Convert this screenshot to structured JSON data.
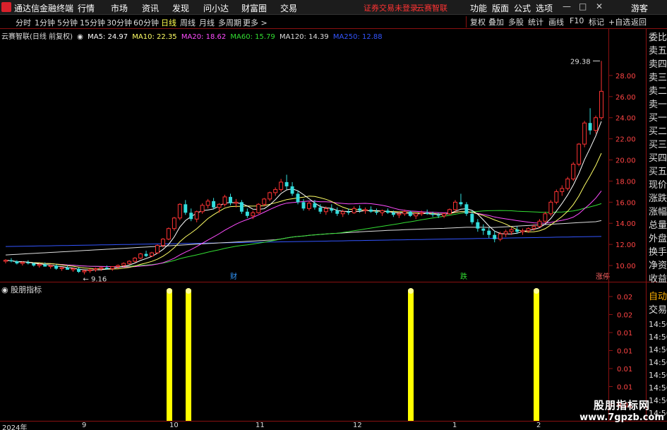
{
  "menubar": {
    "app_title": "通达信金融终端",
    "items": [
      "行情",
      "市场",
      "资讯",
      "发现",
      "问小达",
      "财富圈",
      "交易"
    ],
    "alert": "证券交易未登录",
    "alert2": "云赛智联",
    "right_items": [
      "功能",
      "版面",
      "公式",
      "选项"
    ],
    "guest": "游客"
  },
  "periodbar": {
    "periods": [
      "分时",
      "1分钟",
      "5分钟",
      "15分钟",
      "30分钟",
      "60分钟",
      "日线",
      "周线",
      "月线",
      "多周期",
      "更多 >"
    ],
    "active": "日线",
    "tools": [
      "复权",
      "叠加",
      "多股",
      "统计",
      "画线",
      "F10",
      "标记",
      "+自选",
      "返回"
    ]
  },
  "main_chart": {
    "title": "云赛智联(日线 前复权)",
    "ma": [
      {
        "label": "MA5: 24.97",
        "color": "#ffffff"
      },
      {
        "label": "MA10: 22.35",
        "color": "#ffff66"
      },
      {
        "label": "MA20: 18.62",
        "color": "#ff4dff"
      },
      {
        "label": "MA60: 15.79",
        "color": "#33dd33"
      },
      {
        "label": "MA120: 14.39",
        "color": "#dddddd"
      },
      {
        "label": "MA250: 12.88",
        "color": "#3355ff"
      }
    ],
    "high_label": "29.38",
    "low_label": "9.16",
    "event_markers": [
      "财",
      "跌",
      "涨停"
    ]
  },
  "indicator": {
    "title": "股朋指标"
  },
  "side_panel": {
    "items": [
      "委比",
      "卖五",
      "卖四",
      "卖三",
      "卖二",
      "卖一",
      "买一",
      "买二",
      "买三",
      "买四",
      "买五",
      "现价",
      "涨跌",
      "涨幅",
      "总量",
      "外盘",
      "换手",
      "净资",
      "收益"
    ],
    "lower_items": [
      "自动",
      "交易",
      "14:56",
      "14:56",
      "14:56",
      "14:56",
      "14:56",
      "14:56",
      "14:56",
      "14:56"
    ]
  },
  "dates": [
    "2024年",
    "9",
    "10",
    "11",
    "12",
    "1",
    "2"
  ],
  "watermark": {
    "line1": "股朋指标网",
    "line2": "www.7gpzb.com"
  },
  "chart_data": {
    "type": "candlestick",
    "y_axis_ticks": [
      "28.00",
      "26.00",
      "24.00",
      "22.00",
      "20.00",
      "18.00",
      "16.00",
      "14.00",
      "12.00",
      "10.00"
    ],
    "ylim": [
      9.0,
      30.0
    ],
    "indicator_ticks": [
      "0.02",
      "0.02",
      "0.01",
      "0.01",
      "0.01",
      "0.01",
      "0.01",
      "0.01"
    ],
    "signal_bars": [
      1,
      1,
      1,
      1
    ],
    "candles": [
      [
        10.4,
        10.6,
        10.2,
        10.5
      ],
      [
        10.5,
        10.7,
        10.3,
        10.4
      ],
      [
        10.4,
        10.5,
        10.1,
        10.2
      ],
      [
        10.2,
        10.4,
        10.0,
        10.3
      ],
      [
        10.3,
        10.5,
        10.1,
        10.2
      ],
      [
        10.2,
        10.3,
        9.9,
        10.0
      ],
      [
        10.0,
        10.2,
        9.8,
        10.1
      ],
      [
        10.1,
        10.3,
        9.9,
        9.9
      ],
      [
        9.9,
        10.1,
        9.7,
        10.0
      ],
      [
        10.0,
        10.1,
        9.6,
        9.7
      ],
      [
        9.7,
        9.9,
        9.5,
        9.8
      ],
      [
        9.8,
        10.0,
        9.6,
        9.6
      ],
      [
        9.6,
        9.8,
        9.4,
        9.7
      ],
      [
        9.7,
        9.8,
        9.3,
        9.4
      ],
      [
        9.4,
        9.6,
        9.16,
        9.5
      ],
      [
        9.5,
        9.7,
        9.3,
        9.6
      ],
      [
        9.6,
        9.8,
        9.4,
        9.7
      ],
      [
        9.7,
        9.9,
        9.5,
        9.8
      ],
      [
        9.8,
        10.0,
        9.6,
        9.7
      ],
      [
        9.7,
        9.9,
        9.5,
        9.9
      ],
      [
        9.9,
        10.1,
        9.7,
        10.0
      ],
      [
        10.0,
        10.3,
        9.9,
        10.2
      ],
      [
        10.2,
        10.5,
        10.1,
        10.4
      ],
      [
        10.4,
        10.8,
        10.3,
        10.7
      ],
      [
        10.7,
        11.2,
        10.6,
        11.1
      ],
      [
        11.1,
        11.4,
        10.8,
        10.9
      ],
      [
        10.9,
        11.3,
        10.8,
        11.2
      ],
      [
        11.2,
        12.0,
        11.1,
        11.9
      ],
      [
        11.9,
        12.6,
        11.7,
        12.5
      ],
      [
        12.5,
        13.6,
        12.4,
        13.5
      ],
      [
        13.5,
        14.6,
        13.3,
        14.5
      ],
      [
        14.5,
        15.9,
        14.3,
        15.8
      ],
      [
        15.8,
        16.2,
        14.8,
        15.0
      ],
      [
        15.0,
        15.4,
        14.2,
        14.4
      ],
      [
        14.4,
        15.2,
        14.1,
        15.1
      ],
      [
        15.1,
        15.9,
        14.9,
        15.7
      ],
      [
        15.7,
        16.3,
        15.4,
        16.1
      ],
      [
        16.1,
        16.4,
        15.3,
        15.5
      ],
      [
        15.5,
        15.9,
        15.0,
        15.8
      ],
      [
        15.8,
        16.7,
        15.6,
        16.5
      ],
      [
        16.5,
        16.8,
        15.7,
        15.9
      ],
      [
        15.9,
        16.3,
        15.5,
        16.0
      ],
      [
        16.0,
        16.2,
        14.9,
        15.1
      ],
      [
        15.1,
        15.4,
        14.5,
        14.7
      ],
      [
        14.7,
        15.2,
        14.4,
        15.0
      ],
      [
        15.0,
        15.9,
        14.9,
        15.8
      ],
      [
        15.8,
        16.4,
        15.6,
        16.3
      ],
      [
        16.3,
        17.0,
        16.1,
        16.9
      ],
      [
        16.9,
        17.4,
        16.6,
        17.2
      ],
      [
        17.2,
        18.2,
        17.0,
        17.9
      ],
      [
        17.9,
        18.6,
        17.2,
        17.5
      ],
      [
        17.5,
        17.9,
        16.6,
        16.8
      ],
      [
        16.8,
        17.1,
        15.8,
        16.0
      ],
      [
        16.0,
        16.3,
        15.2,
        15.4
      ],
      [
        15.4,
        16.1,
        15.2,
        15.9
      ],
      [
        15.9,
        16.2,
        15.3,
        15.5
      ],
      [
        15.5,
        15.8,
        14.9,
        15.1
      ],
      [
        15.1,
        15.6,
        14.8,
        15.4
      ],
      [
        15.4,
        15.8,
        15.0,
        15.2
      ],
      [
        15.2,
        15.5,
        14.7,
        14.9
      ],
      [
        14.9,
        15.3,
        14.6,
        15.1
      ],
      [
        15.1,
        15.4,
        14.8,
        15.0
      ],
      [
        15.0,
        15.6,
        14.9,
        15.4
      ],
      [
        15.4,
        15.7,
        15.0,
        15.2
      ],
      [
        15.2,
        15.5,
        14.9,
        15.3
      ],
      [
        15.3,
        15.6,
        15.0,
        15.1
      ],
      [
        15.1,
        15.4,
        14.8,
        15.0
      ],
      [
        15.0,
        15.3,
        14.7,
        15.2
      ],
      [
        15.2,
        15.4,
        14.9,
        15.0
      ],
      [
        15.0,
        15.2,
        14.6,
        14.8
      ],
      [
        14.8,
        15.1,
        14.5,
        14.9
      ],
      [
        14.9,
        15.3,
        14.7,
        15.1
      ],
      [
        15.1,
        15.2,
        14.6,
        14.7
      ],
      [
        14.7,
        15.0,
        14.4,
        14.9
      ],
      [
        14.9,
        15.2,
        14.7,
        15.0
      ],
      [
        15.0,
        15.3,
        14.8,
        14.9
      ],
      [
        14.9,
        15.1,
        14.6,
        14.8
      ],
      [
        14.8,
        15.0,
        14.5,
        14.7
      ],
      [
        14.7,
        15.0,
        14.5,
        14.9
      ],
      [
        14.9,
        15.4,
        14.8,
        15.3
      ],
      [
        15.3,
        16.2,
        15.1,
        16.0
      ],
      [
        16.0,
        16.8,
        15.6,
        15.8
      ],
      [
        15.8,
        16.0,
        14.7,
        14.9
      ],
      [
        14.9,
        15.2,
        13.9,
        14.1
      ],
      [
        14.1,
        14.4,
        13.2,
        13.5
      ],
      [
        13.5,
        13.9,
        12.9,
        13.3
      ],
      [
        13.3,
        13.6,
        12.6,
        12.9
      ],
      [
        12.9,
        13.3,
        12.2,
        12.5
      ],
      [
        12.5,
        13.2,
        12.3,
        13.0
      ],
      [
        13.0,
        13.4,
        12.7,
        13.2
      ],
      [
        13.2,
        13.6,
        12.9,
        13.4
      ],
      [
        13.4,
        13.7,
        13.0,
        13.2
      ],
      [
        13.2,
        13.5,
        12.9,
        13.3
      ],
      [
        13.3,
        13.6,
        13.1,
        13.5
      ],
      [
        13.5,
        13.9,
        13.3,
        13.7
      ],
      [
        13.7,
        14.4,
        13.6,
        14.2
      ],
      [
        14.2,
        15.1,
        14.0,
        14.9
      ],
      [
        14.9,
        16.2,
        14.7,
        16.0
      ],
      [
        16.0,
        17.2,
        15.8,
        17.0
      ],
      [
        17.0,
        17.6,
        16.6,
        17.3
      ],
      [
        17.3,
        18.4,
        17.1,
        18.2
      ],
      [
        18.2,
        19.8,
        18.0,
        19.6
      ],
      [
        19.6,
        21.6,
        19.4,
        21.5
      ],
      [
        21.5,
        23.7,
        21.2,
        23.5
      ],
      [
        23.5,
        24.9,
        22.4,
        22.8
      ],
      [
        22.8,
        24.2,
        22.5,
        24.0
      ],
      [
        24.0,
        29.38,
        23.8,
        26.5
      ]
    ]
  }
}
